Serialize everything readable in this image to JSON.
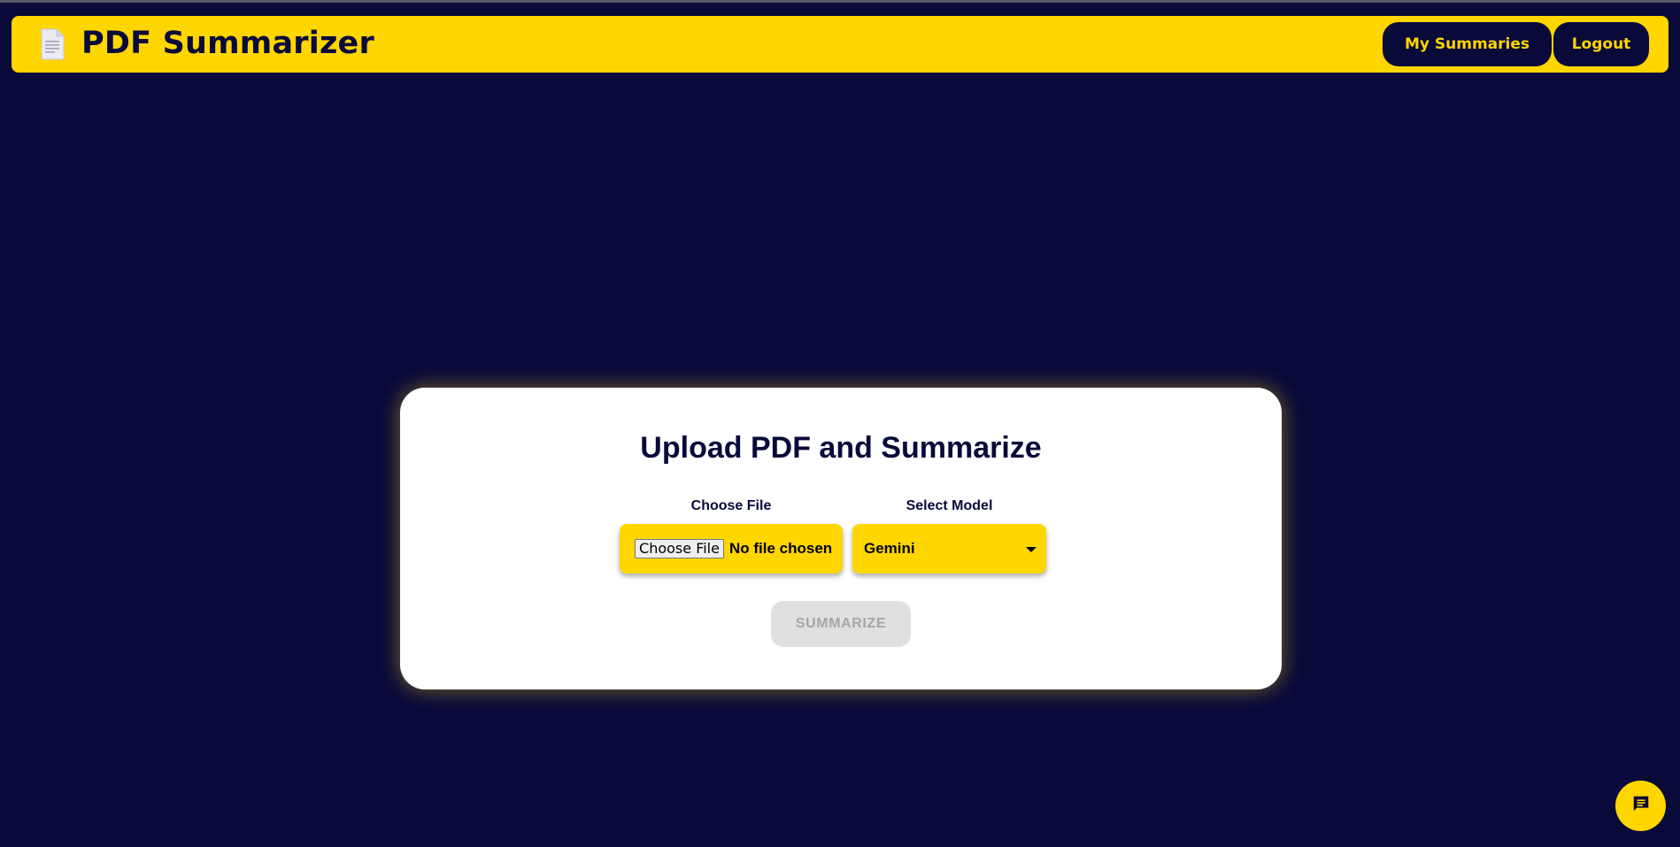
{
  "header": {
    "app_title": "PDF Summarizer",
    "logo_icon": "document-icon",
    "nav": {
      "my_summaries_label": "My Summaries",
      "logout_label": "Logout"
    }
  },
  "upload_card": {
    "title": "Upload PDF and Summarize",
    "file_field": {
      "label": "Choose File",
      "button_label": "Choose File",
      "status": "No file chosen"
    },
    "model_field": {
      "label": "Select Model",
      "selected_value": "Gemini"
    },
    "summarize_label": "SUMMARIZE",
    "summarize_enabled": false
  },
  "chat_button": {
    "icon": "chat-icon"
  },
  "colors": {
    "background": "#09093a",
    "accent": "#ffd600",
    "card": "#ffffff",
    "disabled_button": "#e0e0e0"
  }
}
